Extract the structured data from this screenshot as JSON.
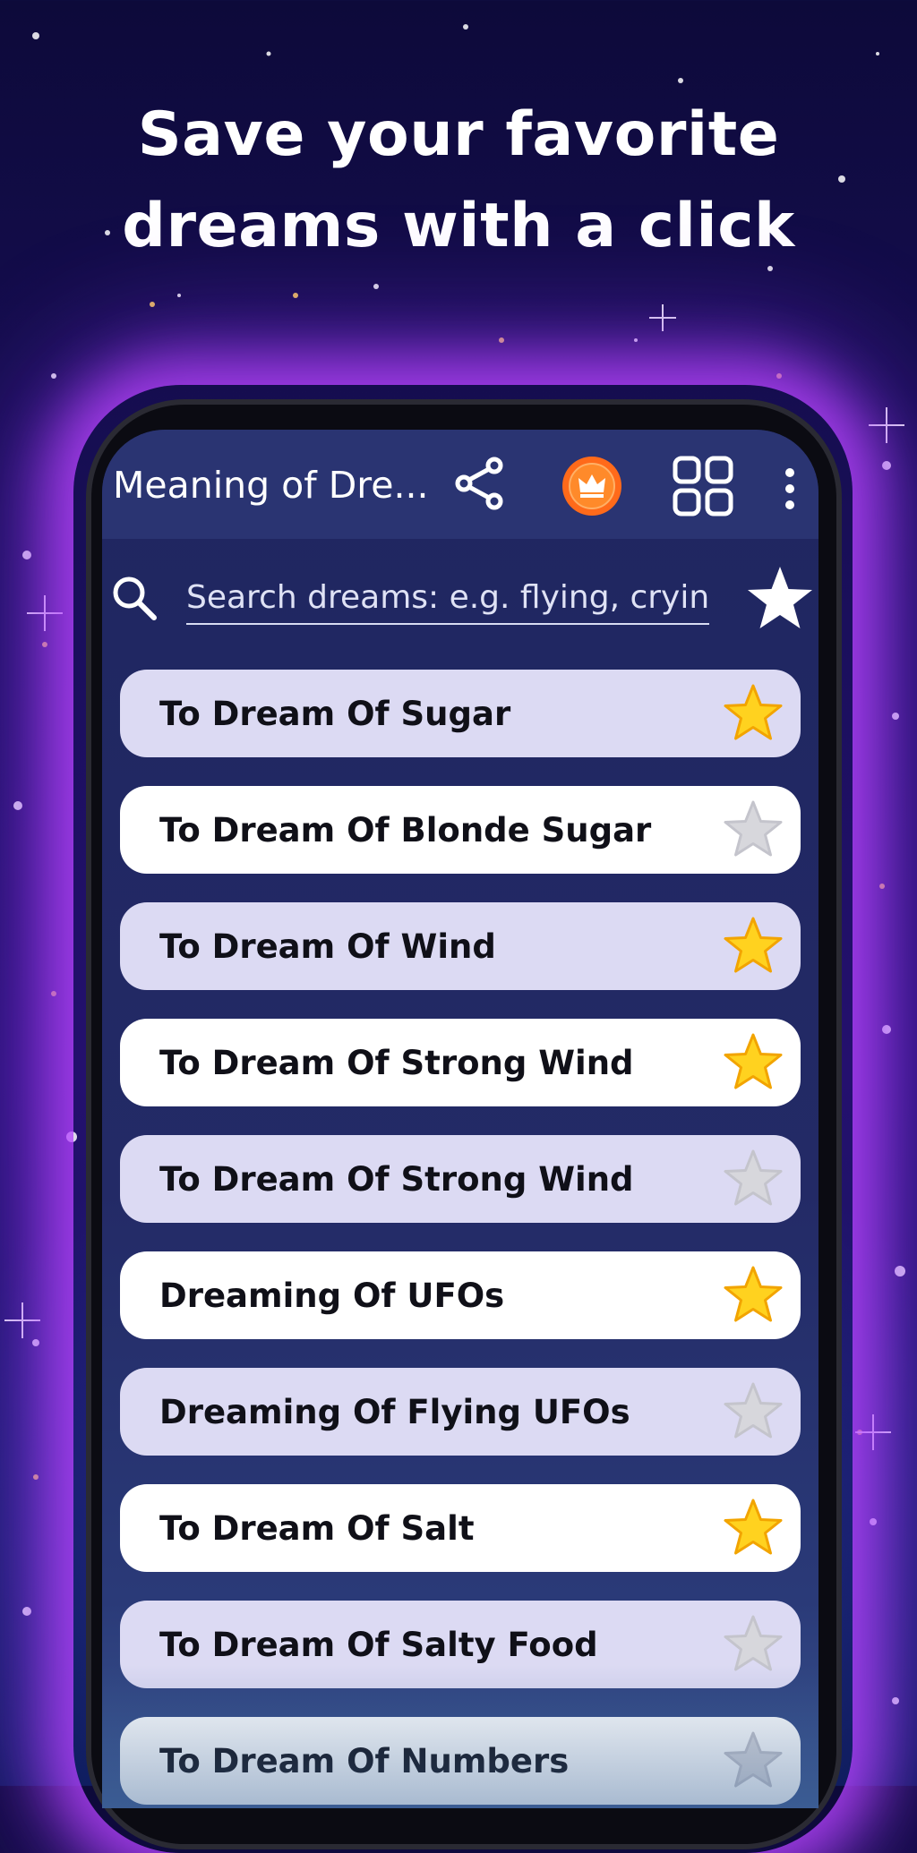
{
  "promo": {
    "headline_line1": "Save your favorite",
    "headline_line2": "dreams with a click"
  },
  "app": {
    "title": "Meaning of Dre...",
    "icons": [
      "share-icon",
      "crown-icon",
      "grid-icon",
      "more-vert-icon"
    ]
  },
  "search": {
    "placeholder": "Search dreams: e.g. flying, cryin..."
  },
  "colors": {
    "appbar": "#2a3472",
    "screen_bg": "#1f2660",
    "row_shaded": "#dcdaf3",
    "row_plain": "#ffffff",
    "star_on": "#ffd21f",
    "star_off": "#d7d7dc"
  },
  "dreams": [
    {
      "label": "To Dream Of Sugar",
      "favorite": true
    },
    {
      "label": "To Dream Of Blonde Sugar",
      "favorite": false
    },
    {
      "label": "To Dream Of Wind",
      "favorite": true
    },
    {
      "label": "To Dream Of Strong Wind",
      "favorite": true
    },
    {
      "label": "To Dream Of Strong Wind",
      "favorite": false
    },
    {
      "label": "Dreaming Of UFOs",
      "favorite": true
    },
    {
      "label": "Dreaming Of Flying UFOs",
      "favorite": false
    },
    {
      "label": "To Dream Of Salt",
      "favorite": true
    },
    {
      "label": "To Dream Of Salty Food",
      "favorite": false
    },
    {
      "label": "To Dream Of Numbers",
      "favorite": false
    }
  ]
}
